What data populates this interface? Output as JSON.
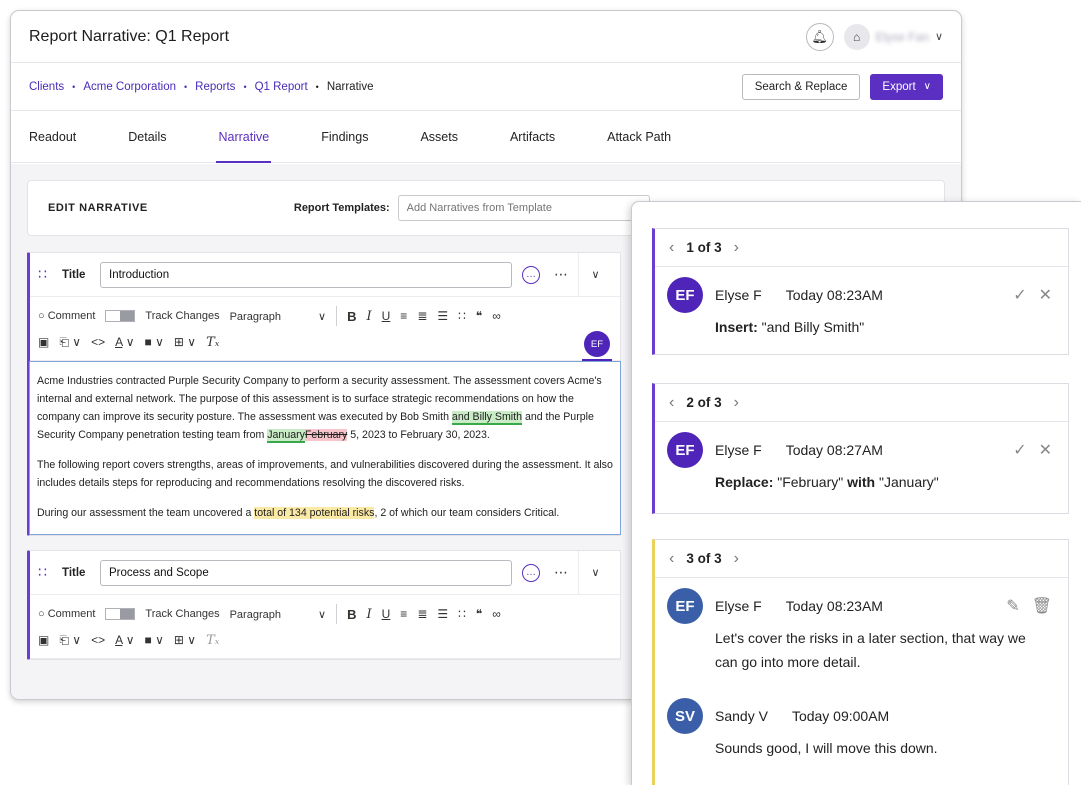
{
  "window": {
    "title": "Report Narrative: Q1 Report",
    "user_name": "Elyse Fan"
  },
  "breadcrumb": {
    "items": [
      "Clients",
      "Acme Corporation",
      "Reports",
      "Q1 Report"
    ],
    "current": "Narrative",
    "separator": "•"
  },
  "actions": {
    "search_replace": "Search & Replace",
    "export": "Export"
  },
  "tabs": [
    "Readout",
    "Details",
    "Narrative",
    "Findings",
    "Assets",
    "Artifacts",
    "Attack Path"
  ],
  "active_tab": "Narrative",
  "edit_card": {
    "heading": "EDIT NARRATIVE",
    "templates_label": "Report Templates:",
    "templates_placeholder": "Add Narratives from Template"
  },
  "toolbar": {
    "comment": "Comment",
    "track_changes": "Track Changes",
    "paragraph": "Paragraph",
    "badge": "EF"
  },
  "sections": [
    {
      "title_label": "Title",
      "title_value": "Introduction",
      "p1_a": "Acme Industries contracted Purple Security Company to perform a security assessment. The assessment covers Acme's internal and external network. The purpose of this assessment is to surface strategic recommendations on how the company can improve its security posture. The assessment was executed by Bob Smith ",
      "p1_ins": "and Billy Smith",
      "p1_b": " and the Purple Security Company penetration testing team from ",
      "p1_ins2": "January",
      "p1_del": "February",
      "p1_c": " 5, 2023 to February 30, 2023.",
      "p2": "The following report covers strengths, areas of improvements, and vulnerabilities discovered during the assessment. It also includes details steps for reproducing and recommendations resolving the discovered risks.",
      "p3_a": "During our assessment the team uncovered a ",
      "p3_hl": "total of 134 potential risks",
      "p3_b": ", 2 of which our team considers Critical."
    },
    {
      "title_label": "Title",
      "title_value": "Process and Scope"
    }
  ],
  "threads": [
    {
      "nav": "1 of 3",
      "comments": [
        {
          "initials": "EF",
          "name": "Elyse F",
          "time": "Today 08:23AM",
          "label": "Insert:",
          "text": " \"and Billy Smith\""
        }
      ]
    },
    {
      "nav": "2 of 3",
      "comments": [
        {
          "initials": "EF",
          "name": "Elyse F",
          "time": "Today 08:27AM",
          "label": "Replace:",
          "text": " \"February\" ",
          "label2": "with",
          "text2": " \"January\""
        }
      ]
    },
    {
      "nav": "3 of 3",
      "comments": [
        {
          "initials": "EF",
          "name": "Elyse F",
          "time": "Today 08:23AM",
          "text": "Let's cover the risks in a later section, that way we can go into more detail."
        },
        {
          "initials": "SV",
          "name": "Sandy V",
          "time": "Today 09:00AM",
          "text": "Sounds good, I will move this down."
        }
      ]
    }
  ],
  "colors": {
    "accent": "#5a2fc2",
    "insert_bg": "#c9ebc6",
    "delete_bg": "#f6c4ca",
    "highlight_bg": "#fbe9a6",
    "thread_yellow": "#ecd25a"
  },
  "icons": [
    "bell-icon",
    "user-icon",
    "chevron-down-icon",
    "drag-handle-icon",
    "comment-icon",
    "more-icon",
    "check-icon",
    "close-icon",
    "edit-icon",
    "trash-icon"
  ]
}
